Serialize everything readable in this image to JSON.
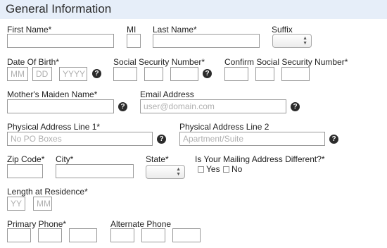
{
  "header": {
    "title": "General Information"
  },
  "labels": {
    "first_name": "First Name*",
    "mi": "MI",
    "last_name": "Last Name*",
    "suffix": "Suffix",
    "dob": "Date Of Birth*",
    "ssn": "Social Security Number*",
    "confirm_ssn": "Confirm Social Security Number*",
    "maiden_name": "Mother's Maiden Name*",
    "email": "Email Address",
    "address1": "Physical Address Line 1*",
    "address2": "Physical Address Line 2",
    "zip": "Zip Code*",
    "city": "City*",
    "state": "State*",
    "mailing_diff": "Is Your Mailing Address Different?*",
    "yes": "Yes",
    "no": "No",
    "length_residence": "Length at Residence*",
    "primary_phone": "Primary Phone*",
    "alternate_phone": "Alternate Phone"
  },
  "placeholders": {
    "dob_month": "MM",
    "dob_day": "DD",
    "dob_year": "YYYY",
    "email": "user@domain.com",
    "address1": "No PO Boxes",
    "address2": "Apartment/Suite",
    "res_years": "YY",
    "res_months": "MM"
  },
  "help_icon": "?",
  "icons": {
    "help": "question-circle-icon",
    "select_arrows": "up-down-arrows-icon"
  },
  "colors": {
    "header_bg": "#e6eef9",
    "help_icon_bg": "#2b2b2b"
  }
}
